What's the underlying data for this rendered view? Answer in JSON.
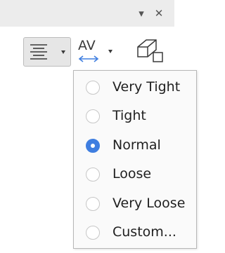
{
  "panel": {
    "dropdown_glyph": "▾",
    "close_glyph": "✕"
  },
  "toolbar": {
    "align_icon": "align-center-icon",
    "spacing_icon": "character-spacing-icon",
    "spacing_text": "AV",
    "border_icon": "cell-border-icon"
  },
  "spacing_menu": {
    "items": [
      {
        "label": "Very Tight",
        "checked": false
      },
      {
        "label": "Tight",
        "checked": false
      },
      {
        "label": "Normal",
        "checked": true
      },
      {
        "label": "Loose",
        "checked": false
      },
      {
        "label": "Very Loose",
        "checked": false
      },
      {
        "label": "Custom...",
        "checked": false
      }
    ],
    "accent_color": "#3f7ee0"
  }
}
